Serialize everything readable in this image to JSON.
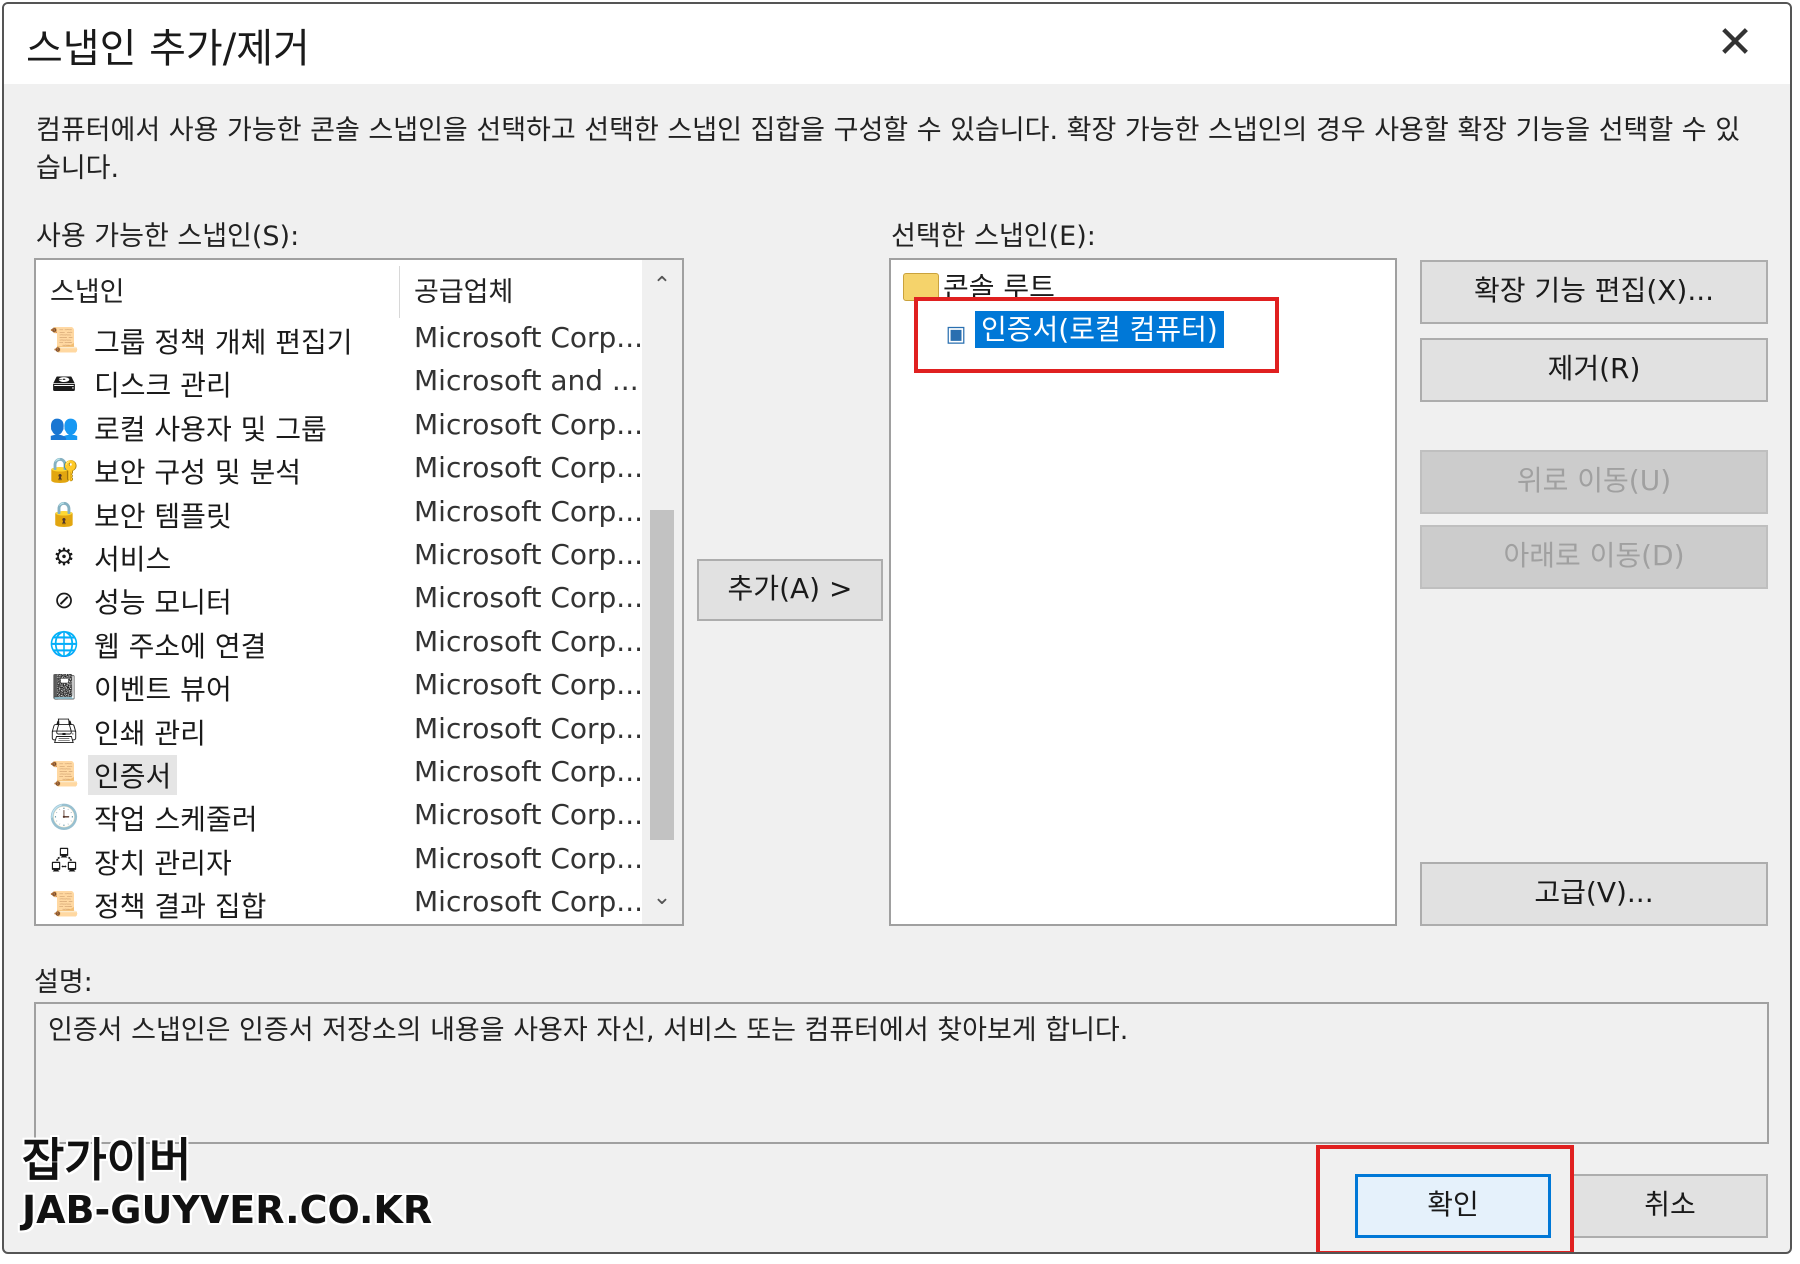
{
  "window": {
    "title": "스냅인 추가/제거",
    "close_glyph": "✕"
  },
  "intro_text": "컴퓨터에서 사용 가능한 콘솔 스냅인을 선택하고 선택한 스냅인 집합을 구성할 수 있습니다. 확장 가능한 스냅인의 경우 사용할 확장 기능을 선택할 수 있습니다.",
  "available": {
    "label": "사용 가능한 스냅인(S):",
    "columns": [
      "스냅인",
      "공급업체"
    ],
    "scroll_up_glyph": "⌃",
    "scroll_down_glyph": "⌄",
    "items": [
      {
        "name": "그룹 정책 개체 편집기",
        "vendor": "Microsoft Corp...",
        "icon": "policy-icon",
        "glyph": "📜"
      },
      {
        "name": "디스크 관리",
        "vendor": "Microsoft and ...",
        "icon": "disk-icon",
        "glyph": "🖴"
      },
      {
        "name": "로컬 사용자 및 그룹",
        "vendor": "Microsoft Corp...",
        "icon": "users-icon",
        "glyph": "👥"
      },
      {
        "name": "보안 구성 및 분석",
        "vendor": "Microsoft Corp...",
        "icon": "security-analysis-icon",
        "glyph": "🔐"
      },
      {
        "name": "보안 템플릿",
        "vendor": "Microsoft Corp...",
        "icon": "security-template-icon",
        "glyph": "🔒"
      },
      {
        "name": "서비스",
        "vendor": "Microsoft Corp...",
        "icon": "services-gear-icon",
        "glyph": "⚙"
      },
      {
        "name": "성능 모니터",
        "vendor": "Microsoft Corp...",
        "icon": "performance-monitor-icon",
        "glyph": "⊘"
      },
      {
        "name": "웹 주소에 연결",
        "vendor": "Microsoft Corp...",
        "icon": "web-link-icon",
        "glyph": "🌐"
      },
      {
        "name": "이벤트 뷰어",
        "vendor": "Microsoft Corp...",
        "icon": "event-viewer-icon",
        "glyph": "📓"
      },
      {
        "name": "인쇄 관리",
        "vendor": "Microsoft Corp...",
        "icon": "printer-icon",
        "glyph": "🖨"
      },
      {
        "name": "인증서",
        "vendor": "Microsoft Corp...",
        "icon": "certificate-icon",
        "glyph": "📜",
        "selected": true
      },
      {
        "name": "작업 스케줄러",
        "vendor": "Microsoft Corp...",
        "icon": "clock-icon",
        "glyph": "🕒"
      },
      {
        "name": "장치 관리자",
        "vendor": "Microsoft Corp...",
        "icon": "device-manager-icon",
        "glyph": "🖧"
      },
      {
        "name": "정책 결과 집합",
        "vendor": "Microsoft Corp...",
        "icon": "policy-result-icon",
        "glyph": "📜"
      }
    ]
  },
  "add_button": "추가(A) >",
  "selected": {
    "label": "선택한 스냅인(E):",
    "root": "콘솔 루트",
    "child": "인증서(로컬 컴퓨터)"
  },
  "side_buttons": {
    "edit_extensions": "확장 기능 편집(X)...",
    "remove": "제거(R)",
    "move_up": "위로 이동(U)",
    "move_down": "아래로 이동(D)",
    "advanced": "고급(V)..."
  },
  "description": {
    "label": "설명:",
    "text": "인증서 스냅인은 인증서 저장소의 내용을 사용자 자신, 서비스 또는 컴퓨터에서 찾아보게 합니다."
  },
  "footer": {
    "ok": "확인",
    "cancel": "취소"
  },
  "watermark": {
    "line1": "잡가이버",
    "line2": "JAB-GUYVER.CO.KR"
  },
  "colors": {
    "highlight": "#0078d7",
    "annotation_red": "#e02020",
    "dialog_bg": "#f0f0f0"
  }
}
